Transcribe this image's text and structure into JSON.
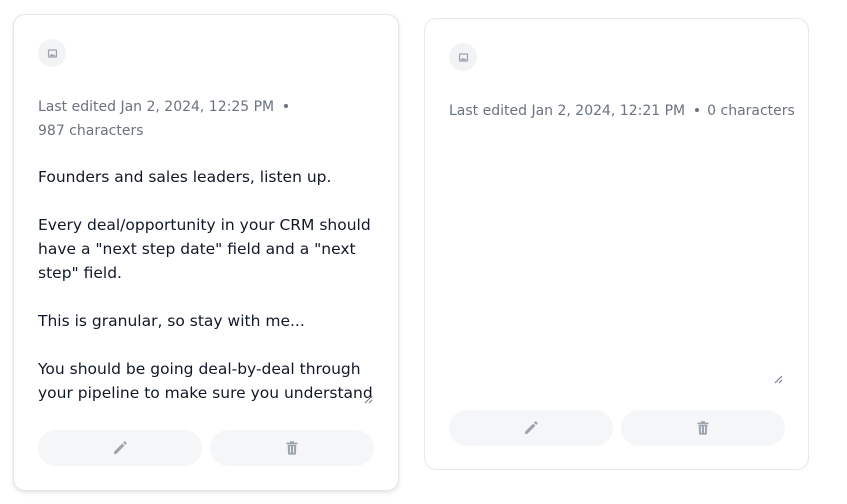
{
  "colors": {
    "text": "#111827",
    "muted": "#6b7280",
    "icon": "#9ca3af",
    "button_bg": "#f5f6f8",
    "border": "#e5e7eb"
  },
  "notes": [
    {
      "image_icon": "image-icon",
      "last_edited": "Last edited Jan 2, 2024, 12:25 PM",
      "char_count": "987 characters",
      "body": "Founders and sales leaders, listen up.\n\nEvery deal/opportunity in your CRM should have a \"next step date\" field and a \"next step\" field.\n\nThis is granular, so stay with me...\n\nYou should be going deal-by-deal through your pipeline to make sure you understand",
      "edit_icon": "pencil-icon",
      "delete_icon": "trash-icon"
    },
    {
      "image_icon": "image-icon",
      "last_edited": "Last edited Jan 2, 2024, 12:21 PM",
      "char_count": "0 characters",
      "body": "",
      "edit_icon": "pencil-icon",
      "delete_icon": "trash-icon"
    }
  ]
}
